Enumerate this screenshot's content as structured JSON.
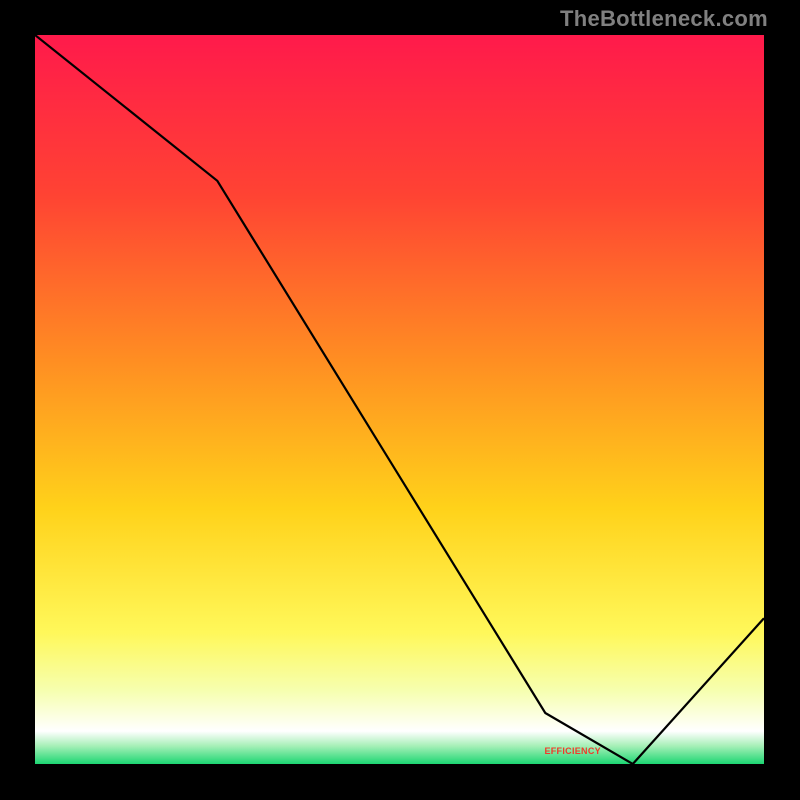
{
  "watermark": "TheBottleneck.com",
  "axis_label_text": "EFFICIENCY",
  "chart_data": {
    "type": "line",
    "xlim": [
      0,
      100
    ],
    "ylim": [
      0,
      100
    ],
    "line": {
      "x": [
        0,
        25,
        70,
        82,
        100
      ],
      "y": [
        100,
        80,
        7,
        0,
        20
      ]
    },
    "background_gradient_stops": [
      {
        "pos": 0.0,
        "color": "#ff1a4b"
      },
      {
        "pos": 0.22,
        "color": "#ff4333"
      },
      {
        "pos": 0.45,
        "color": "#ff8f22"
      },
      {
        "pos": 0.65,
        "color": "#ffd21a"
      },
      {
        "pos": 0.82,
        "color": "#fff85a"
      },
      {
        "pos": 0.9,
        "color": "#f6ffb0"
      },
      {
        "pos": 0.955,
        "color": "#ffffff"
      },
      {
        "pos": 0.975,
        "color": "#a7f0b8"
      },
      {
        "pos": 1.0,
        "color": "#1cd672"
      }
    ],
    "badge_x_fraction": 0.74
  }
}
